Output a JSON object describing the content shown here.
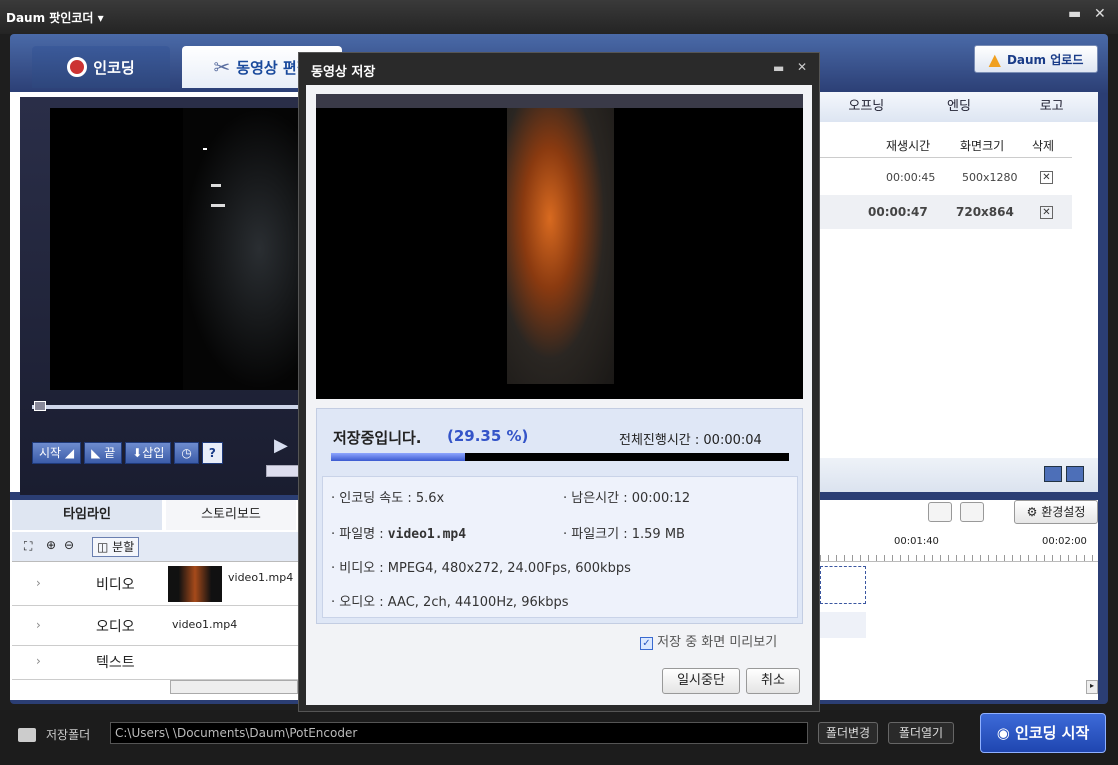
{
  "app": {
    "title": "Daum 팟인코더 ▾"
  },
  "tabs": {
    "encoding": "인코딩",
    "editing": "동영상 편집"
  },
  "upload_label": "Daum 업로드",
  "right_panel": {
    "tabs": [
      "오프닝",
      "엔딩",
      "로고"
    ],
    "columns": [
      "재생시간",
      "화면크기",
      "삭제"
    ],
    "rows": [
      {
        "duration": "00:00:45",
        "size": "500x1280"
      },
      {
        "duration": "00:00:47",
        "size": "720x864"
      }
    ]
  },
  "player_controls": {
    "start": "시작",
    "end": "끝",
    "insert": "삽입",
    "help": "?"
  },
  "bottom": {
    "tabs": [
      "타임라인",
      "스토리보드"
    ],
    "split_label": "분할",
    "settings_label": "환경설정",
    "ruler": [
      "00:01:40",
      "00:02:00"
    ],
    "tracks": [
      {
        "name": "비디오",
        "clip": "video1.mp4"
      },
      {
        "name": "오디오",
        "clip": "video1.mp4"
      },
      {
        "name": "텍스트",
        "clip": ""
      }
    ]
  },
  "footer": {
    "folder_label": "저장폴더",
    "path": "C:\\Users\\       \\Documents\\Daum\\PotEncoder",
    "change_folder": "폴더변경",
    "open_folder": "폴더열기",
    "start_encoding": "인코딩 시작"
  },
  "dialog": {
    "title": "동영상 저장",
    "status": "저장중입니다.",
    "percent_text": "(29.35 %)",
    "progress": 29.35,
    "elapsed": "전체진행시간 : 00:00:04",
    "speed": "· 인코딩 속도 : 5.6x",
    "remaining": "· 남은시간 : 00:00:12",
    "filename_label": "· 파일명 : ",
    "filename": "video1.mp4",
    "filesize": "· 파일크기 : 1.59 MB",
    "video": "· 비디오 : MPEG4, 480x272, 24.00Fps, 600kbps",
    "audio": "· 오디오 : AAC, 2ch, 44100Hz, 96kbps",
    "preview_label": "저장 중 화면 미리보기",
    "pause": "일시중단",
    "cancel": "취소"
  }
}
